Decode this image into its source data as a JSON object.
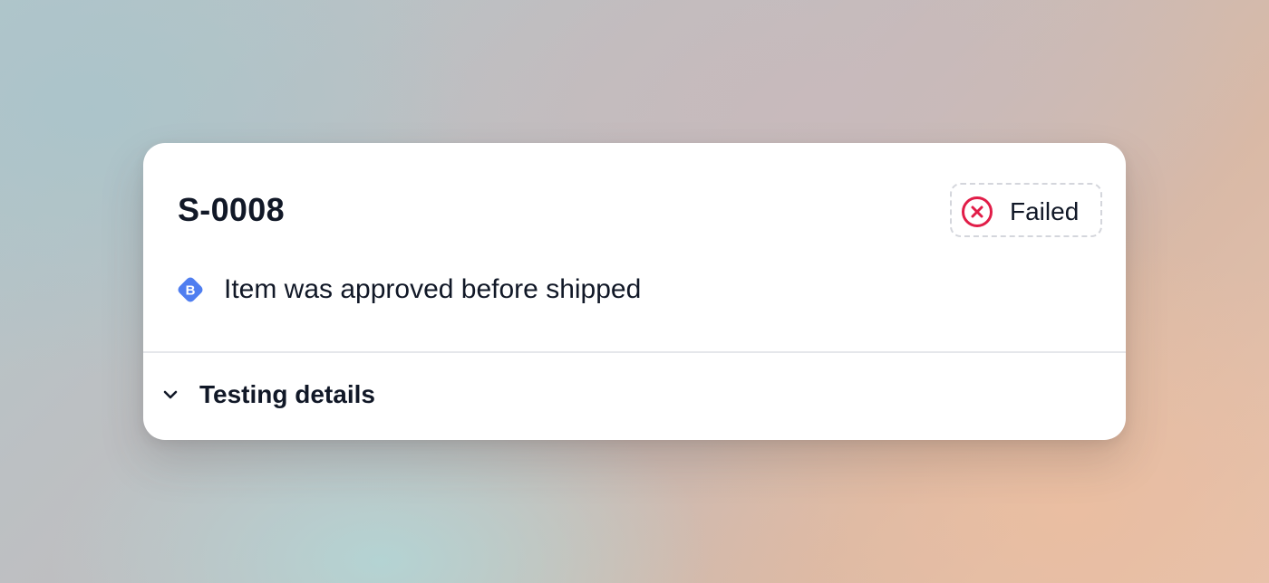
{
  "card": {
    "id_label": "S-0008",
    "status": {
      "label": "Failed",
      "icon": "x-circle-icon",
      "color": "#e11d48"
    },
    "rule": {
      "badge_letter": "B",
      "badge_icon": "diamond-badge-icon",
      "badge_color": "#4f7ef0",
      "text": "Item was approved before shipped"
    },
    "details": {
      "label": "Testing details",
      "icon": "chevron-down-icon"
    }
  }
}
